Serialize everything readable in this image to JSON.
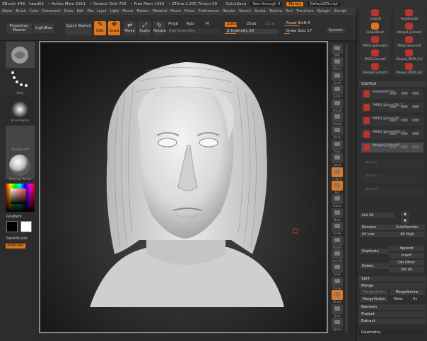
{
  "titlebar": {
    "app": "ZBrush 4R6",
    "doc": "head52",
    "active_mem": "• Active Mem 1911",
    "scratch": "• Scratch Disk 750",
    "free_mem": "• Free Mem 1493",
    "ztime": "• ZTime:1.205 Timer>29",
    "quicksave": "QuickSave",
    "seethrough": "See-through  0",
    "menus": "Menus",
    "script": "DefaultZScript"
  },
  "menubar": [
    "Alpha",
    "Brush",
    "Color",
    "Document",
    "Draw",
    "Edit",
    "File",
    "Layer",
    "Light",
    "Macro",
    "Marker",
    "Material",
    "Movie",
    "Picker",
    "Preferences",
    "Render",
    "Stencil",
    "Stroke",
    "Texture",
    "Tool",
    "Transform",
    "Zplugin",
    "Zscript"
  ],
  "shelf": {
    "projection_master": "Projection Master",
    "lightbox": "LightBox",
    "quick_sketch": "Quick Sketch",
    "edit": "Edit",
    "draw": "Draw",
    "move": "Move",
    "scale": "Scale",
    "rotate": "Rotate",
    "mrgb": "Mrgb",
    "rgb": "Rgb",
    "m": "M",
    "rgb_intensity": "Rgb Intensity",
    "zadd": "Zadd",
    "zsub": "Zsub",
    "zcut": "Zcut",
    "z_intensity": "Z Intensity 20",
    "focal_shift": "Focal Shift 0",
    "draw_size": "Draw Size 17",
    "dynamic": "Dynamic"
  },
  "lefttray": {
    "brush": "Std_Zbrush2",
    "stroke": "Dots",
    "alpha": "Brushalpha",
    "texture": "Texture Off",
    "material": "MatCap White",
    "gradient": "Gradient",
    "switchcolor": "SwitchColor",
    "alternate": "Alternate"
  },
  "rightstrip": [
    "BPR",
    "SPix 3",
    "Scroll",
    "Zoom",
    "Actual",
    "AAHalf",
    "Persp",
    "Floor",
    "Local",
    "L.Sym",
    "Xyz",
    "Frame",
    "Move",
    "Scale",
    "Rotate",
    "Line Fill",
    "PolyF",
    "Transp",
    "Ghost",
    "Solo",
    "Xpose"
  ],
  "toolgrid": [
    "Cube3D",
    "PolyMesh3D",
    "SimpleBrush",
    "Merged_Extract4",
    "PM3D_Sphere3D1",
    "PM3D_Sphere3D",
    "PM3D_Extract3",
    "Merged_PM3D_Ext",
    "Merged_Extract4",
    "Merged_PM3D_Ext"
  ],
  "subtool": {
    "header": "SubTool",
    "items": [
      "Huehead2 try",
      "PM3D_Sphere3D_5",
      "PM3D_Sphere3D",
      "PM3D_Sphere3D1_1",
      "Merged_Extract5"
    ],
    "empty": [
      "None 6",
      "None 7",
      "None 8"
    ]
  },
  "panel": {
    "list_all": "List All",
    "rename": "Rename",
    "autoreorder": "AutoReorder",
    "all_low": "All Low",
    "all_high": "All High",
    "duplicate": "Duplicate",
    "append": "Append",
    "insert": "Insert",
    "delete": "Delete",
    "del_other": "Del Other",
    "del_all": "Del All",
    "split": "Split",
    "merge": "Merge",
    "mergedown": "MergeDown",
    "mergesimilar": "MergeSimilar",
    "mergevisible": "MergeVisible",
    "weld": "Weld",
    "uv": "Uv",
    "remesh": "Remesh",
    "project": "Project",
    "extract": "Extract",
    "geometry": "Geometry"
  },
  "colors": {
    "accent": "#e0761b",
    "viewport": "#1a1a1a"
  }
}
